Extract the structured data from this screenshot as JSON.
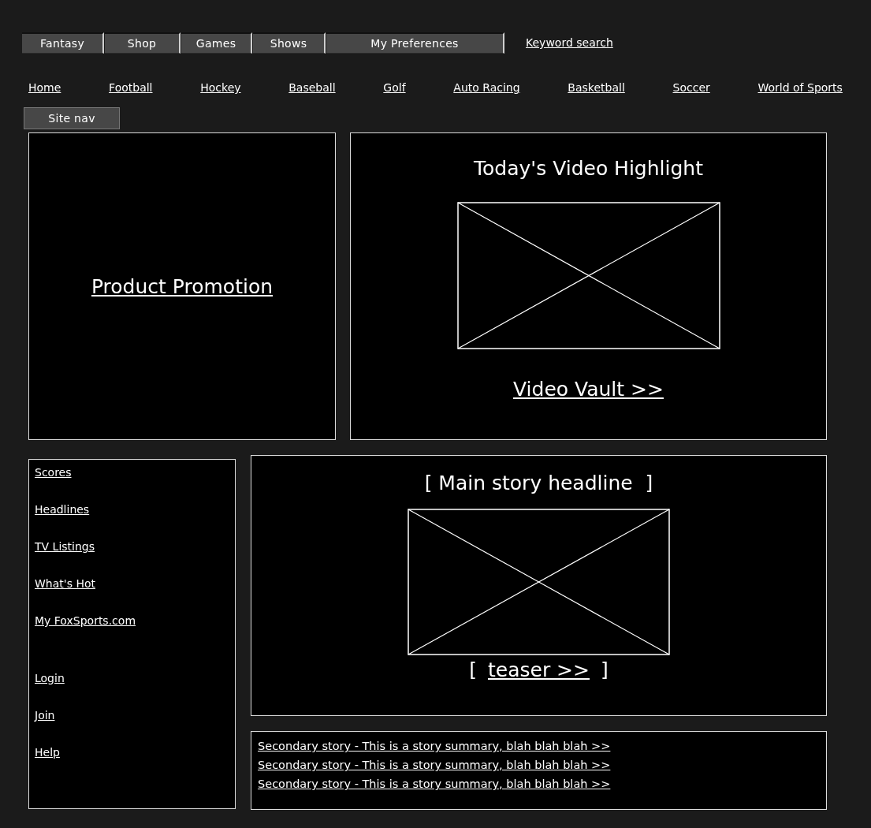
{
  "tabs": [
    {
      "label": "Fantasy"
    },
    {
      "label": "Shop"
    },
    {
      "label": "Games"
    },
    {
      "label": "Shows"
    },
    {
      "label": "My Preferences"
    }
  ],
  "keyword_search": "Keyword search",
  "sport_links": [
    "Home",
    "Football",
    "Hockey",
    "Baseball",
    "Golf",
    "Auto Racing",
    "Basketball",
    "Soccer",
    "World of Sports"
  ],
  "site_nav_button": "Site nav",
  "promo": {
    "link": "Product Promotion"
  },
  "video": {
    "title": "Today's Video Highlight",
    "link": "Video Vault >>"
  },
  "sidebar": {
    "items": [
      "Scores",
      "Headlines",
      "TV Listings",
      "What's Hot",
      "My FoxSports.com"
    ],
    "account_items": [
      "Login",
      "Join",
      "Help"
    ]
  },
  "main_story": {
    "headline": "[ Main story headline  ]",
    "teaser_open": "[",
    "teaser": "teaser >>",
    "teaser_close": "]"
  },
  "secondary_stories": [
    "Secondary story - This is a story summary, blah blah blah >>",
    "Secondary story - This is a story summary, blah blah blah >>",
    "Secondary story - This is a story summary, blah blah blah >>"
  ]
}
